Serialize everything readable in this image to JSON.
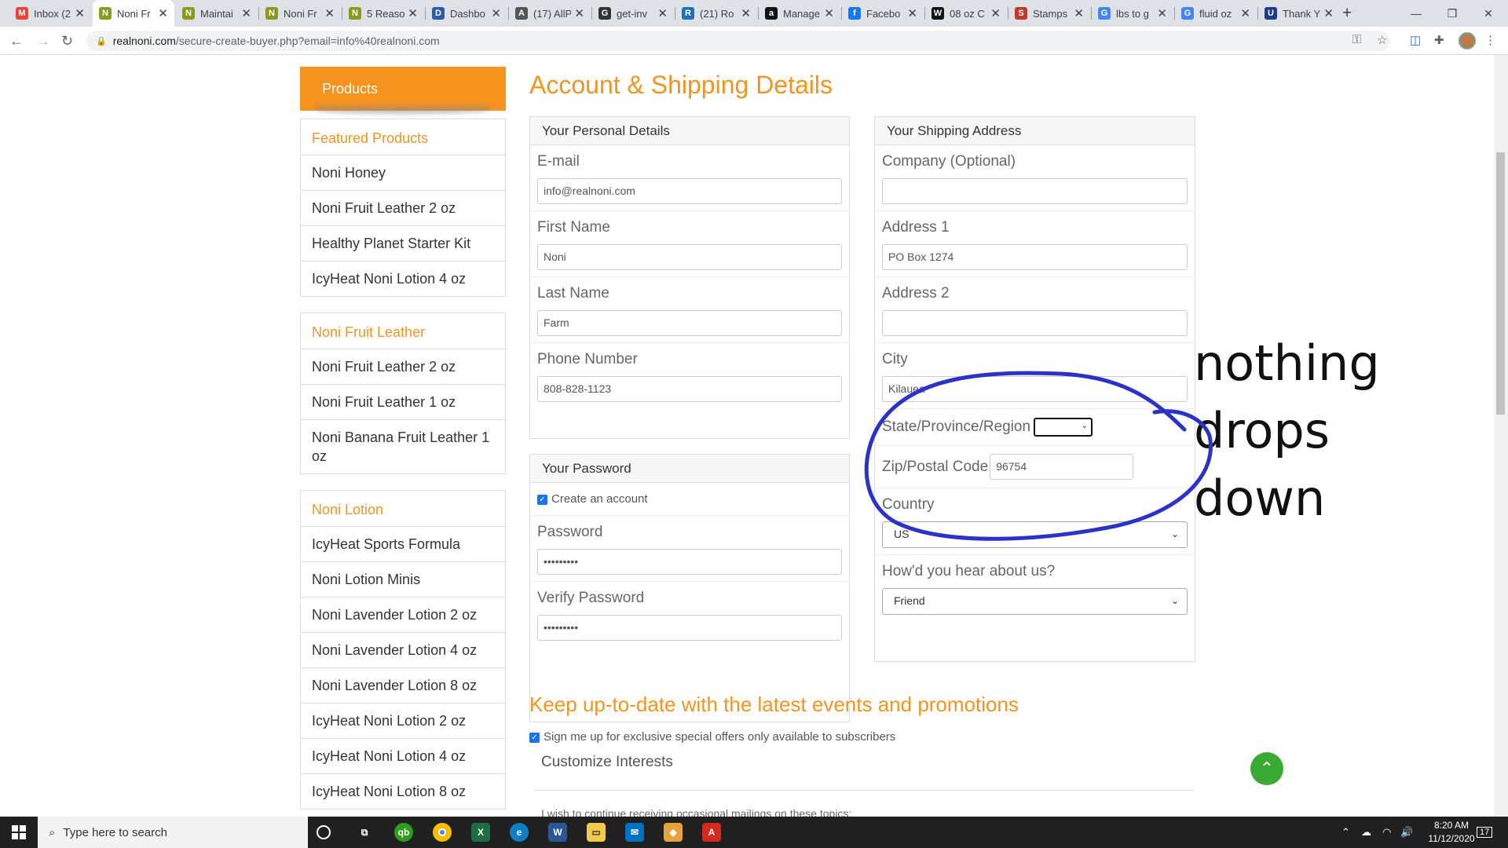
{
  "browser": {
    "tabs": [
      {
        "title": "Inbox (2",
        "icon": "gmail-icon",
        "color": "#ea4335",
        "glyph": "M"
      },
      {
        "title": "Noni Fr",
        "icon": "noni-icon",
        "color": "#8a9a1e",
        "glyph": "N"
      },
      {
        "title": "Maintai",
        "icon": "noni-icon",
        "color": "#8a9a1e",
        "glyph": "N"
      },
      {
        "title": "Noni Fr",
        "icon": "noni-icon",
        "color": "#8a9a1e",
        "glyph": "N"
      },
      {
        "title": "5 Reaso",
        "icon": "noni-icon",
        "color": "#8a9a1e",
        "glyph": "N"
      },
      {
        "title": "Dashbo",
        "icon": "globe-icon",
        "color": "#2a5aa8",
        "glyph": "D"
      },
      {
        "title": "(17) AllP",
        "icon": "globe-icon",
        "color": "#555555",
        "glyph": "A"
      },
      {
        "title": "get-inv",
        "icon": "globe-icon",
        "color": "#333333",
        "glyph": "G"
      },
      {
        "title": "(21) Ro",
        "icon": "bird-icon",
        "color": "#1d6fb8",
        "glyph": "R"
      },
      {
        "title": "Manage",
        "icon": "amazon-icon",
        "color": "#111111",
        "glyph": "a"
      },
      {
        "title": "Facebo",
        "icon": "facebook-icon",
        "color": "#1877f2",
        "glyph": "f"
      },
      {
        "title": "08 oz C",
        "icon": "w-icon",
        "color": "#111111",
        "glyph": "W"
      },
      {
        "title": "Stamps",
        "icon": "stamps-icon",
        "color": "#c0392b",
        "glyph": "S"
      },
      {
        "title": "lbs to g",
        "icon": "google-icon",
        "color": "#4285f4",
        "glyph": "G"
      },
      {
        "title": "fluid oz",
        "icon": "google-icon",
        "color": "#4285f4",
        "glyph": "G"
      },
      {
        "title": "Thank Y",
        "icon": "ups-icon",
        "color": "#1a3a8a",
        "glyph": "U"
      }
    ],
    "url_host": "realnoni.com",
    "url_path": "/secure-create-buyer.php?email=info%40realnoni.com"
  },
  "sidebar": {
    "header": "Products",
    "groups": [
      {
        "title": "Featured Products",
        "items": [
          "Noni Honey",
          "Noni Fruit Leather 2 oz",
          "Healthy Planet Starter Kit",
          "IcyHeat Noni Lotion 4 oz"
        ]
      },
      {
        "title": "Noni Fruit Leather",
        "items": [
          "Noni Fruit Leather 2 oz",
          "Noni Fruit Leather 1 oz",
          "Noni Banana Fruit Leather 1 oz"
        ]
      },
      {
        "title": "Noni Lotion",
        "items": [
          "IcyHeat Sports Formula",
          "Noni Lotion Minis",
          "Noni Lavender Lotion 2 oz",
          "Noni Lavender Lotion 4 oz",
          "Noni Lavender Lotion 8 oz",
          "IcyHeat Noni Lotion 2 oz",
          "IcyHeat Noni Lotion 4 oz",
          "IcyHeat Noni Lotion 8 oz"
        ]
      }
    ]
  },
  "main": {
    "title": "Account & Shipping Details",
    "personal": {
      "header": "Your Personal Details",
      "email_label": "E-mail",
      "email_value": "info@realnoni.com",
      "first_label": "First Name",
      "first_value": "Noni",
      "last_label": "Last Name",
      "last_value": "Farm",
      "phone_label": "Phone Number",
      "phone_value": "808-828-1123"
    },
    "password": {
      "header": "Your Password",
      "create_label": "Create an account",
      "pw_label": "Password",
      "pw_value": "•••••••••",
      "verify_label": "Verify Password",
      "verify_value": "•••••••••"
    },
    "shipping": {
      "header": "Your Shipping Address",
      "company_label": "Company (Optional)",
      "company_value": "",
      "addr1_label": "Address 1",
      "addr1_value": "PO Box 1274",
      "addr2_label": "Address 2",
      "addr2_value": "",
      "city_label": "City",
      "city_value": "Kilauea",
      "state_label": "State/Province/Region",
      "state_value": "",
      "zip_label": "Zip/Postal Code",
      "zip_value": "96754",
      "country_label": "Country",
      "country_value": "US",
      "hear_label": "How'd you hear about us?",
      "hear_value": "Friend"
    },
    "promo": {
      "title": "Keep up-to-date with the latest events and promotions",
      "signup_label": "Sign me up for exclusive special offers only available to subscribers",
      "customize_label": "Customize Interests",
      "partial_text": "I wish to continue receiving occasional mailings on these topics:"
    }
  },
  "annotation": {
    "line1": "nothing drops",
    "line2": "down",
    "color": "#2b32c8"
  },
  "taskbar": {
    "search_placeholder": "Type here to search",
    "time": "8:20 AM",
    "date": "11/12/2020",
    "notif_count": "17"
  },
  "colors": {
    "brand_orange": "#f6921e",
    "totop_green": "#3aaa35"
  }
}
